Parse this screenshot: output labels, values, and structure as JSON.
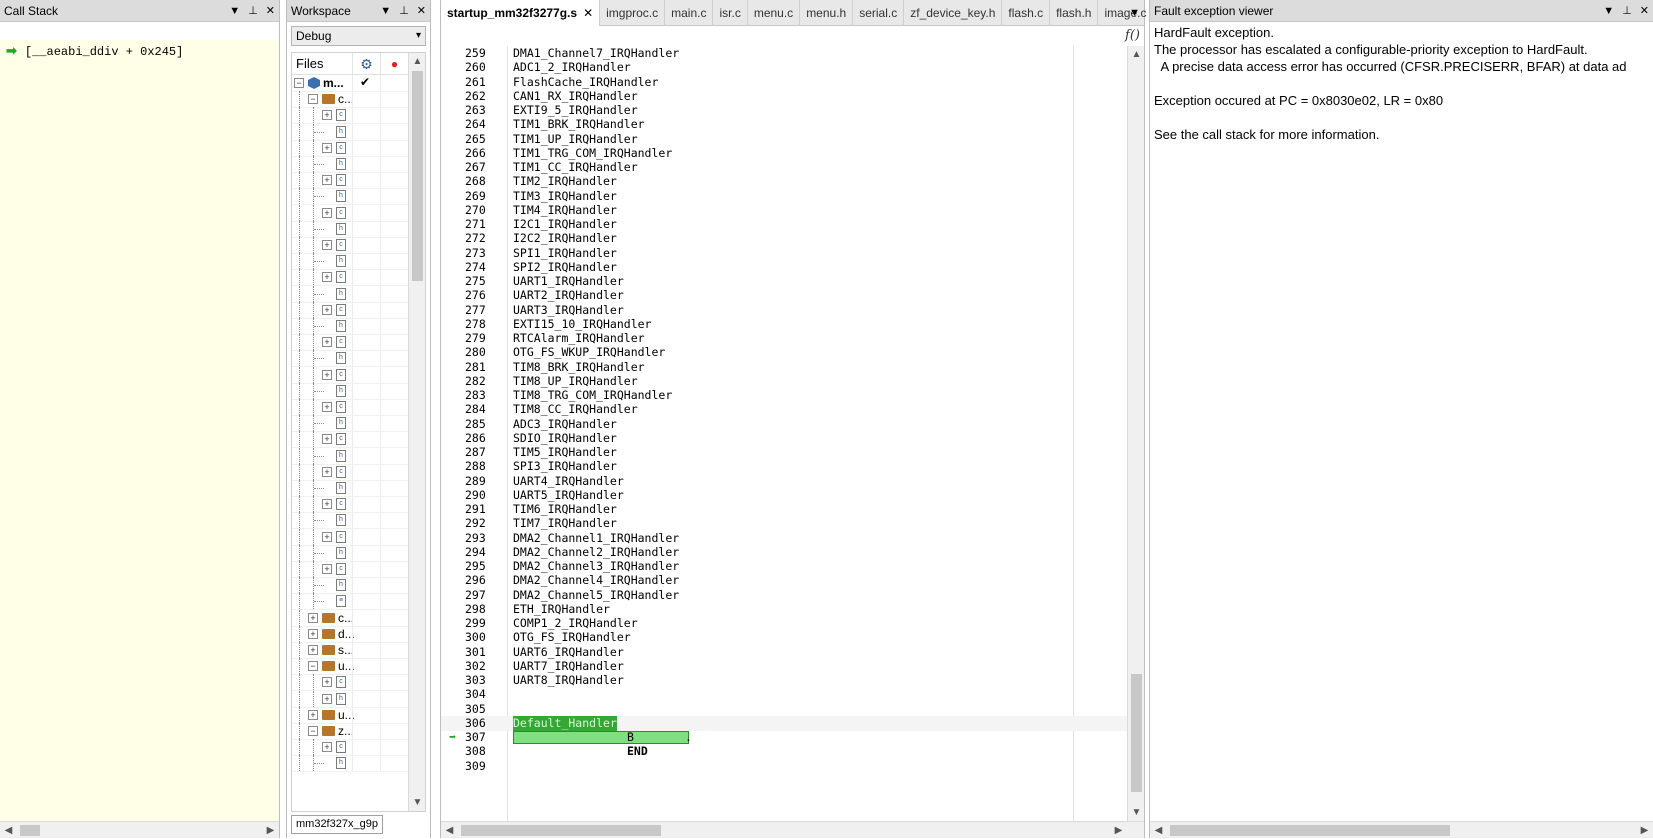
{
  "callstack": {
    "title": "Call Stack",
    "frames": [
      {
        "text": "[__aeabi_ddiv + 0x245]"
      }
    ]
  },
  "workspace": {
    "title": "Workspace",
    "config": "Debug",
    "files_header": "Files",
    "project_label": "m...",
    "bottom_tab": "mm32f327x_g9p",
    "tree": [
      {
        "type": "folder",
        "expand": "-",
        "label": "c..."
      },
      {
        "type": "file",
        "expand": "+",
        "icon": "c"
      },
      {
        "type": "file",
        "expand": "",
        "icon": "h"
      },
      {
        "type": "file",
        "expand": "+",
        "icon": "c"
      },
      {
        "type": "file",
        "expand": "",
        "icon": "h"
      },
      {
        "type": "file",
        "expand": "+",
        "icon": "c"
      },
      {
        "type": "file",
        "expand": "",
        "icon": "h"
      },
      {
        "type": "file",
        "expand": "+",
        "icon": "c"
      },
      {
        "type": "file",
        "expand": "",
        "icon": "h"
      },
      {
        "type": "file",
        "expand": "+",
        "icon": "c"
      },
      {
        "type": "file",
        "expand": "",
        "icon": "h"
      },
      {
        "type": "file",
        "expand": "+",
        "icon": "c"
      },
      {
        "type": "file",
        "expand": "",
        "icon": "h"
      },
      {
        "type": "file",
        "expand": "+",
        "icon": "c"
      },
      {
        "type": "file",
        "expand": "",
        "icon": "h"
      },
      {
        "type": "file",
        "expand": "+",
        "icon": "c"
      },
      {
        "type": "file",
        "expand": "",
        "icon": "h"
      },
      {
        "type": "file",
        "expand": "+",
        "icon": "c"
      },
      {
        "type": "file",
        "expand": "",
        "icon": "h"
      },
      {
        "type": "file",
        "expand": "+",
        "icon": "c"
      },
      {
        "type": "file",
        "expand": "",
        "icon": "h"
      },
      {
        "type": "file",
        "expand": "+",
        "icon": "c"
      },
      {
        "type": "file",
        "expand": "",
        "icon": "h"
      },
      {
        "type": "file",
        "expand": "+",
        "icon": "c"
      },
      {
        "type": "file",
        "expand": "",
        "icon": "h"
      },
      {
        "type": "file",
        "expand": "+",
        "icon": "c"
      },
      {
        "type": "file",
        "expand": "",
        "icon": "h"
      },
      {
        "type": "file",
        "expand": "+",
        "icon": "c"
      },
      {
        "type": "file",
        "expand": "",
        "icon": "h"
      },
      {
        "type": "file",
        "expand": "+",
        "icon": "c"
      },
      {
        "type": "file",
        "expand": "",
        "icon": "h"
      },
      {
        "type": "file",
        "expand": "",
        "icon": "doc"
      },
      {
        "type": "topfolder",
        "expand": "+",
        "label": "c..."
      },
      {
        "type": "topfolder",
        "expand": "+",
        "label": "d..."
      },
      {
        "type": "topfolder",
        "expand": "+",
        "label": "s..."
      },
      {
        "type": "topfolder",
        "expand": "-",
        "label": "u..."
      },
      {
        "type": "file",
        "expand": "+",
        "icon": "c"
      },
      {
        "type": "file",
        "expand": "+",
        "icon": "h"
      },
      {
        "type": "topfolder",
        "expand": "+",
        "label": "u..."
      },
      {
        "type": "topfolder",
        "expand": "-",
        "label": "z..."
      },
      {
        "type": "file",
        "expand": "+",
        "icon": "c"
      },
      {
        "type": "file",
        "expand": "",
        "icon": "h"
      }
    ]
  },
  "editor": {
    "tabs": [
      {
        "label": "startup_mm32f3277g.s",
        "active": true
      },
      {
        "label": "imgproc.c"
      },
      {
        "label": "main.c"
      },
      {
        "label": "isr.c"
      },
      {
        "label": "menu.c"
      },
      {
        "label": "menu.h"
      },
      {
        "label": "serial.c"
      },
      {
        "label": "zf_device_key.h"
      },
      {
        "label": "flash.c"
      },
      {
        "label": "flash.h"
      },
      {
        "label": "image.c"
      }
    ],
    "close_glyph": "✕",
    "func_button": "f()",
    "lines": [
      {
        "n": "259",
        "t": "DMA1_Channel7_IRQHandler"
      },
      {
        "n": "260",
        "t": "ADC1_2_IRQHandler"
      },
      {
        "n": "261",
        "t": "FlashCache_IRQHandler"
      },
      {
        "n": "262",
        "t": "CAN1_RX_IRQHandler"
      },
      {
        "n": "263",
        "t": "EXTI9_5_IRQHandler"
      },
      {
        "n": "264",
        "t": "TIM1_BRK_IRQHandler"
      },
      {
        "n": "265",
        "t": "TIM1_UP_IRQHandler"
      },
      {
        "n": "266",
        "t": "TIM1_TRG_COM_IRQHandler"
      },
      {
        "n": "267",
        "t": "TIM1_CC_IRQHandler"
      },
      {
        "n": "268",
        "t": "TIM2_IRQHandler"
      },
      {
        "n": "269",
        "t": "TIM3_IRQHandler"
      },
      {
        "n": "270",
        "t": "TIM4_IRQHandler"
      },
      {
        "n": "271",
        "t": "I2C1_IRQHandler"
      },
      {
        "n": "272",
        "t": "I2C2_IRQHandler"
      },
      {
        "n": "273",
        "t": "SPI1_IRQHandler"
      },
      {
        "n": "274",
        "t": "SPI2_IRQHandler"
      },
      {
        "n": "275",
        "t": "UART1_IRQHandler"
      },
      {
        "n": "276",
        "t": "UART2_IRQHandler"
      },
      {
        "n": "277",
        "t": "UART3_IRQHandler"
      },
      {
        "n": "278",
        "t": "EXTI15_10_IRQHandler"
      },
      {
        "n": "279",
        "t": "RTCAlarm_IRQHandler"
      },
      {
        "n": "280",
        "t": "OTG_FS_WKUP_IRQHandler"
      },
      {
        "n": "281",
        "t": "TIM8_BRK_IRQHandler"
      },
      {
        "n": "282",
        "t": "TIM8_UP_IRQHandler"
      },
      {
        "n": "283",
        "t": "TIM8_TRG_COM_IRQHandler"
      },
      {
        "n": "284",
        "t": "TIM8_CC_IRQHandler"
      },
      {
        "n": "285",
        "t": "ADC3_IRQHandler"
      },
      {
        "n": "286",
        "t": "SDIO_IRQHandler"
      },
      {
        "n": "287",
        "t": "TIM5_IRQHandler"
      },
      {
        "n": "288",
        "t": "SPI3_IRQHandler"
      },
      {
        "n": "289",
        "t": "UART4_IRQHandler"
      },
      {
        "n": "290",
        "t": "UART5_IRQHandler"
      },
      {
        "n": "291",
        "t": "TIM6_IRQHandler"
      },
      {
        "n": "292",
        "t": "TIM7_IRQHandler"
      },
      {
        "n": "293",
        "t": "DMA2_Channel1_IRQHandler"
      },
      {
        "n": "294",
        "t": "DMA2_Channel2_IRQHandler"
      },
      {
        "n": "295",
        "t": "DMA2_Channel3_IRQHandler"
      },
      {
        "n": "296",
        "t": "DMA2_Channel4_IRQHandler"
      },
      {
        "n": "297",
        "t": "DMA2_Channel5_IRQHandler"
      },
      {
        "n": "298",
        "t": "ETH_IRQHandler"
      },
      {
        "n": "299",
        "t": "COMP1_2_IRQHandler"
      },
      {
        "n": "300",
        "t": "OTG_FS_IRQHandler"
      },
      {
        "n": "301",
        "t": "UART6_IRQHandler"
      },
      {
        "n": "302",
        "t": "UART7_IRQHandler"
      },
      {
        "n": "303",
        "t": "UART8_IRQHandler"
      },
      {
        "n": "304",
        "t": ""
      },
      {
        "n": "305",
        "t": ""
      },
      {
        "n": "306",
        "t": "Default_Handler",
        "kind": "label"
      },
      {
        "n": "307",
        "t": "B",
        "kind": "exec",
        "suffix": "."
      },
      {
        "n": "308",
        "t": "END",
        "kind": "end"
      },
      {
        "n": "309",
        "t": ""
      }
    ]
  },
  "fault": {
    "title": "Fault exception viewer",
    "lines": [
      "HardFault exception.",
      "The processor has escalated a configurable-priority exception to HardFault.",
      "  A precise data access error has occurred (CFSR.PRECISERR, BFAR) at data ad",
      "",
      "Exception occured at PC = 0x8030e02, LR = 0x80",
      "",
      "See the call stack for more information."
    ]
  },
  "pane_controls": {
    "menu": "▼",
    "pin": "⊥",
    "close": "✕"
  },
  "colors": {
    "exec_green": "#7ee07e",
    "label_green": "#33a833",
    "arrow_green": "#26a626"
  }
}
